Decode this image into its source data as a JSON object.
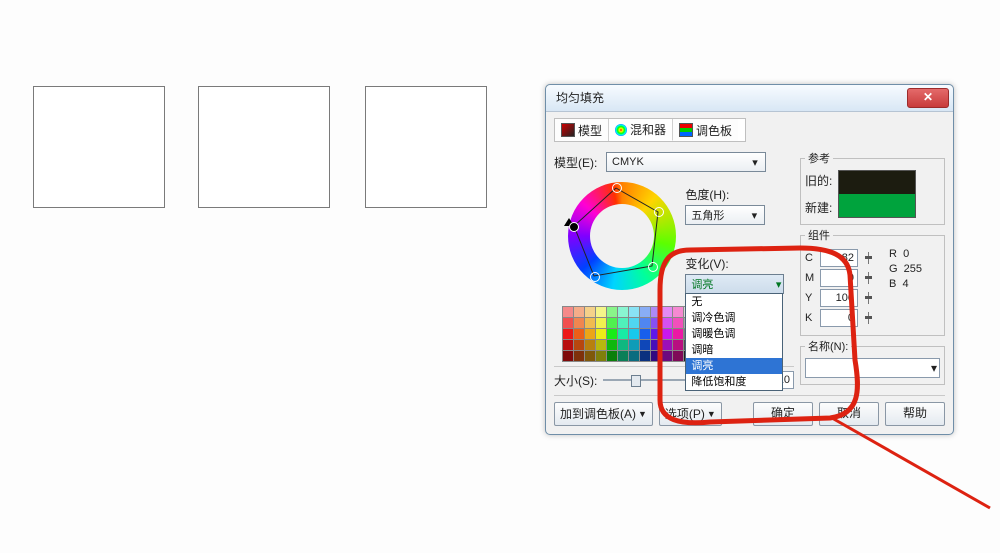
{
  "dialog": {
    "title": "均匀填充",
    "tabs": {
      "model": "模型",
      "mixer": "混和器",
      "palette": "调色板"
    },
    "model_label": "模型(E):",
    "model_value": "CMYK",
    "hue_label": "色度(H):",
    "hue_value": "五角形",
    "variation_label": "变化(V):",
    "variation_value": "调亮",
    "variation_options": [
      "无",
      "调冷色调",
      "调暖色调",
      "调暗",
      "调亮",
      "降低饱和度"
    ],
    "size_label": "大小(S):",
    "size_value": "10"
  },
  "reference": {
    "section": "参考",
    "old_label": "旧的:",
    "new_label": "新建:",
    "old_color": "#1c1c10",
    "new_color": "#00a33d"
  },
  "components": {
    "section": "组件",
    "C": "82",
    "M": "0",
    "Y": "100",
    "K": "0",
    "R": "0",
    "G": "255",
    "B": "4"
  },
  "name_section": {
    "label": "名称(N):"
  },
  "footer": {
    "add_palette": "加到调色板(A)",
    "options": "选项(P)",
    "ok": "确定",
    "cancel": "取消",
    "help": "帮助"
  }
}
